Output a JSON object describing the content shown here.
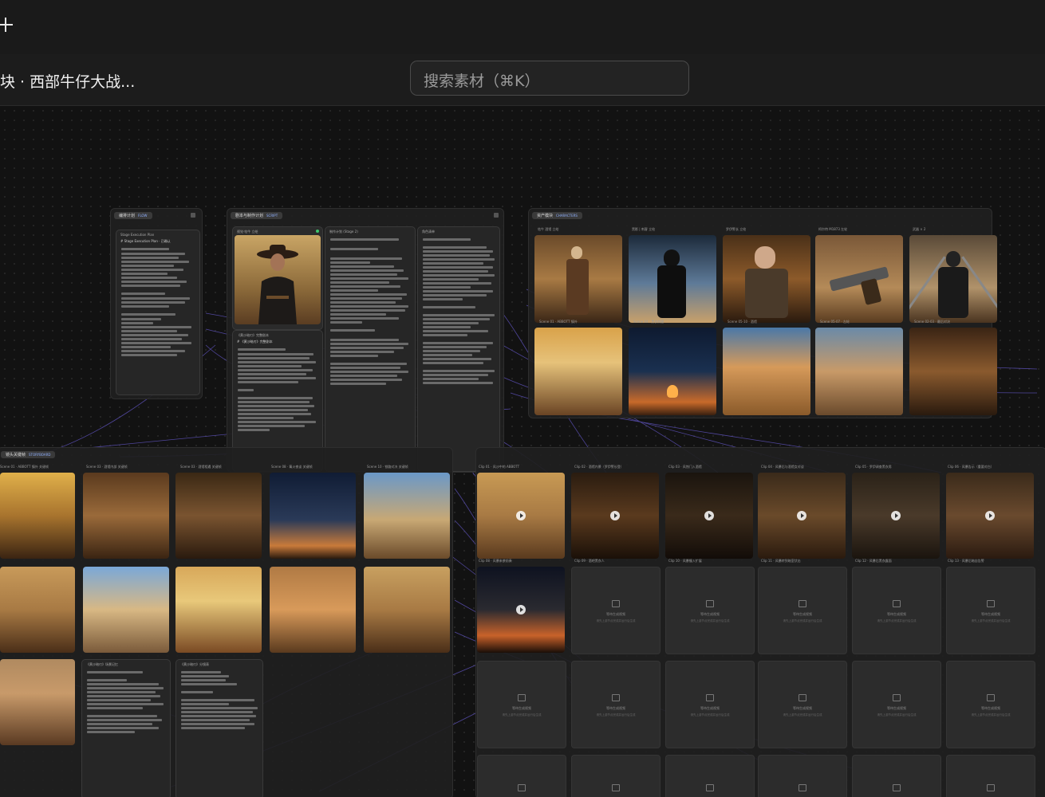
{
  "header": {
    "project_title": "块 · 西部牛仔大战...",
    "search_placeholder": "搜索素材（⌘K）"
  },
  "groups": {
    "flow": {
      "title": "编排计划",
      "tag": "FLOW"
    },
    "script": {
      "title": "剧本与制作计划",
      "tag": "SCRIPT"
    },
    "characters": {
      "title": "资产模块",
      "tag": "CHARACTERS"
    },
    "storyboard": {
      "title": "镜头关键帧",
      "tag": "STORYBOARD"
    }
  },
  "flow_node": {
    "title": "Stage Execution Plan",
    "text": "# Stage Execution Plan · 已确认"
  },
  "script_nodes": {
    "char_title": "视觉·牯牛 立绘",
    "plan_title": "制作计划 (Stage 2)",
    "list_title": "角色清单",
    "script_title": "《黄沙暗刃》完整剧本",
    "script_heading": "# 《黄沙暗刃》完整剧本"
  },
  "char_titles": [
    "牯牛 酒馆 立绘",
    "黑影 | 刺客 立绘",
    "罗伊警长 立绘",
    "柯尔特 M1873 左轮",
    "武器 × 2"
  ],
  "scene_captions": [
    "Scene 01 · ABBOTT 镇外",
    "Scene 04 · 黑衣刺客",
    "Scene 05-10 · 酒馆",
    "Scene 05-07 · 左轮",
    "Scene 02-03 · 最后对决"
  ],
  "storyboard_titles": [
    "Scene 01 · ABBOTT 镇外 关键帧",
    "Scene 03 · 酒馆内部 关键帧",
    "Scene 03 · 酒馆相遇 关键帧",
    "Scene 08 · 篝火夜谈 关键帧",
    "Scene 10 · 铁路对决 关键帧"
  ],
  "storyboard_notes": {
    "memory_title": "《黄沙暗刃》场景记忆",
    "shot_title": "《黄沙暗刃》分镜表"
  },
  "clip_titles": [
    "Clip 01 · 风沙中的 ABBOTT",
    "Clip 02 · 酒馆内景（罗伊警长登）",
    "Clip 03 · 风蚀门入酒馆",
    "Clip 04 · 风暴后与酒馆女对谈",
    "Clip 05 · 罗伊调查黑衣男",
    "Clip 06 · 风暴告示（重要对白）",
    "Clip 08 · 风暴来袭前奏",
    "Clip 09 · 酒吧黑衣人",
    "Clip 10 · 风暴撞入扩展",
    "Clip 11 · 风暴转到暗室伏击",
    "Clip 12 · 风暴后黑衣露面",
    "Clip 13 · 风暴后暗自告警"
  ],
  "placeholder": {
    "title": "等待生成视频",
    "hint": "请先上游节点完成并运行后生成"
  }
}
